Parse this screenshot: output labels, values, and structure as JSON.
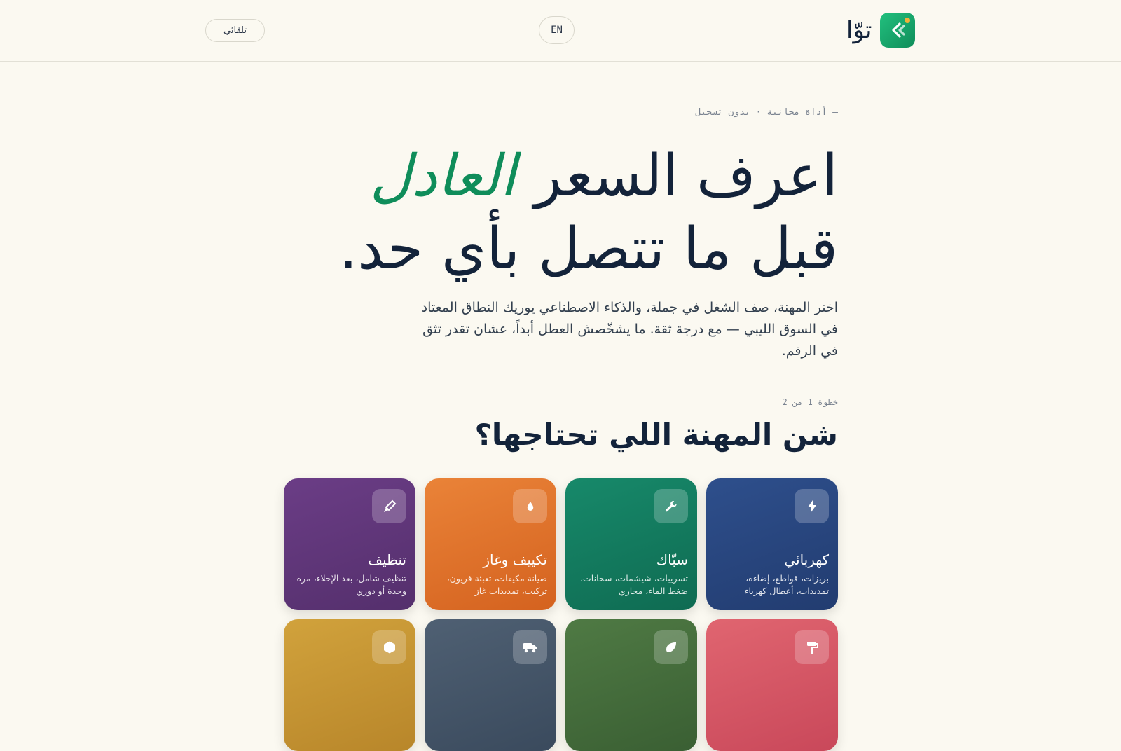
{
  "header": {
    "brand_name": "توّا",
    "lang_button": "EN",
    "auto_button": "تلقائي"
  },
  "hero": {
    "eyebrow": "— أداة مجانية · بدون تسجيل",
    "title_part1": "اعرف السعر ",
    "title_accent": "العادل",
    "title_line2": "قبل ما تتصل بأي حد.",
    "description": "اختر المهنة، صف الشغل في جملة، والذكاء الاصطناعي يوريك النطاق المعتاد في السوق الليبي — مع درجة ثقة. ما يشخّصش العطل أبداً، عشان تقدر تثق في الرقم."
  },
  "step": {
    "label": "خطوة 1 من 2",
    "question": "شن المهنة اللي تحتاجها؟"
  },
  "services": [
    {
      "name": "كهربائي",
      "desc": "بريزات، قواطع، إضاءة، تمديدات، أعطال كهرباء",
      "icon": "bolt-icon",
      "color_from": "#2e4f8c",
      "color_to": "#223c70"
    },
    {
      "name": "سبّاك",
      "desc": "تسريبات، شيشمات، سخانات، ضغط الماء، مجاري",
      "icon": "wrench-icon",
      "color_from": "#17896a",
      "color_to": "#0f6b52"
    },
    {
      "name": "تكييف وغاز",
      "desc": "صيانة مكيفات، تعبئة فريون، تركيب، تمديدات غاز",
      "icon": "drop-icon",
      "color_from": "#ea8338",
      "color_to": "#d4621f"
    },
    {
      "name": "تنظيف",
      "desc": "تنظيف شامل، بعد الإخلاء، مرة وحدة أو دوري",
      "icon": "broom-icon",
      "color_from": "#6b3d86",
      "color_to": "#542f6c"
    },
    {
      "name": "",
      "desc": "",
      "icon": "paint-roller-icon",
      "color_from": "#e06570",
      "color_to": "#c9485a"
    },
    {
      "name": "",
      "desc": "",
      "icon": "leaf-icon",
      "color_from": "#4f7a44",
      "color_to": "#3a5f33"
    },
    {
      "name": "",
      "desc": "",
      "icon": "truck-icon",
      "color_from": "#4f6073",
      "color_to": "#3a4a5d"
    },
    {
      "name": "",
      "desc": "",
      "icon": "box-icon",
      "color_from": "#d1a23c",
      "color_to": "#b8862a"
    }
  ]
}
